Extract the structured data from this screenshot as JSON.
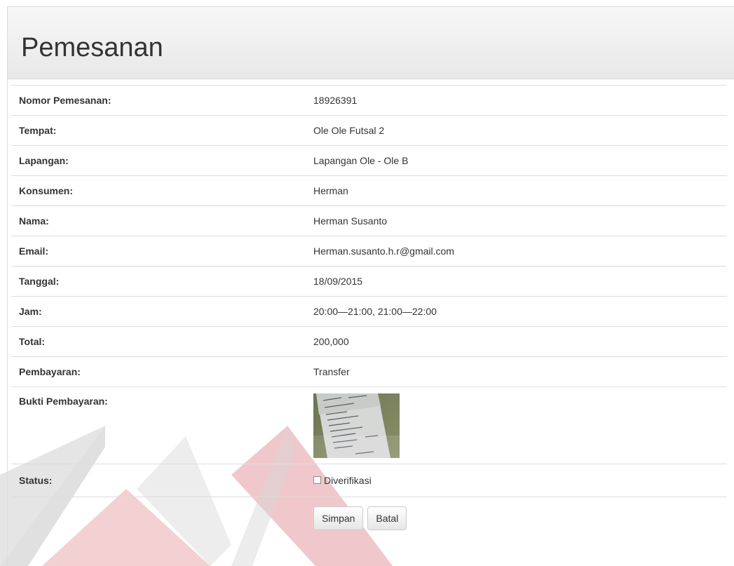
{
  "panel": {
    "title": "Pemesanan"
  },
  "details": [
    {
      "label": "Nomor Pemesanan:",
      "value": "18926391"
    },
    {
      "label": "Tempat:",
      "value": "Ole Ole Futsal 2"
    },
    {
      "label": "Lapangan:",
      "value": "Lapangan Ole - Ole B"
    },
    {
      "label": "Konsumen:",
      "value": "Herman"
    },
    {
      "label": "Nama:",
      "value": "Herman Susanto"
    },
    {
      "label": "Email:",
      "value": "Herman.susanto.h.r@gmail.com"
    },
    {
      "label": "Tanggal:",
      "value": "18/09/2015"
    },
    {
      "label": "Jam:",
      "value": "20:00—21:00, 21:00—22:00"
    },
    {
      "label": "Total:",
      "value": "200,000"
    },
    {
      "label": "Pembayaran:",
      "value": "Transfer"
    }
  ],
  "proof": {
    "label": "Bukti Pembayaran:",
    "image_icon": "receipt-photo"
  },
  "status": {
    "label": "Status:",
    "checkbox_label": "Diverifikasi",
    "checked": false
  },
  "actions": {
    "save_label": "Simpan",
    "cancel_label": "Batal"
  },
  "colors": {
    "watermark_red": "#c8102e",
    "watermark_gray": "#8a8a8a"
  }
}
